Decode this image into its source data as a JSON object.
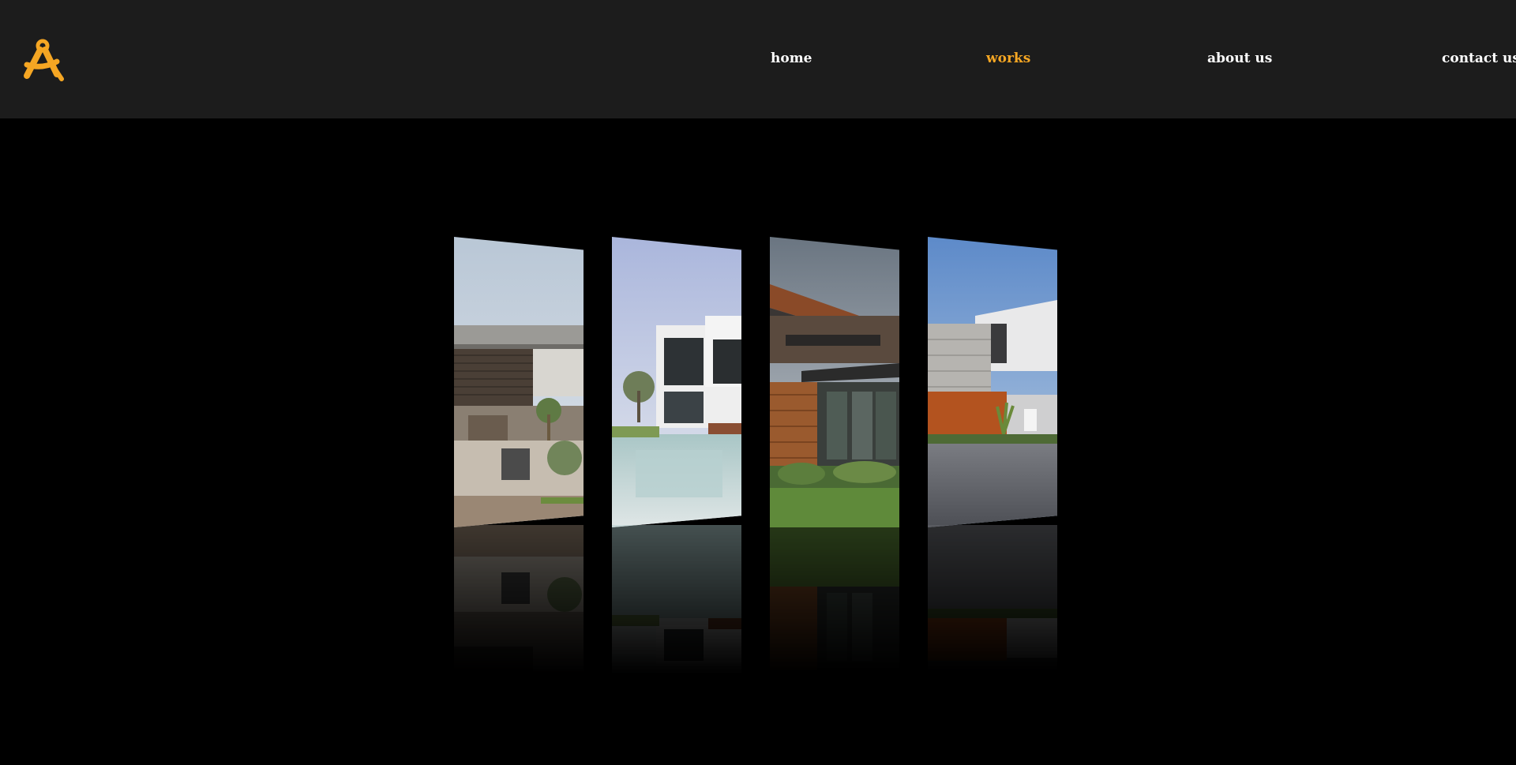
{
  "nav": {
    "logo_icon": "drafting-compass-icon",
    "links": [
      {
        "label": "home",
        "active": false
      },
      {
        "label": "works",
        "active": true
      },
      {
        "label": "about us",
        "active": false
      },
      {
        "label": "contact us",
        "active": false
      }
    ]
  },
  "colors": {
    "accent": "#f5a623",
    "header_bg": "#1c1c1c",
    "page_bg": "#000000",
    "nav_text": "#ffffff"
  },
  "gallery": {
    "items": [
      {
        "image": "modern-house-photo-1"
      },
      {
        "image": "modern-house-pool-photo-2"
      },
      {
        "image": "modern-house-wood-photo-3"
      },
      {
        "image": "modern-house-dusk-photo-4"
      }
    ]
  }
}
